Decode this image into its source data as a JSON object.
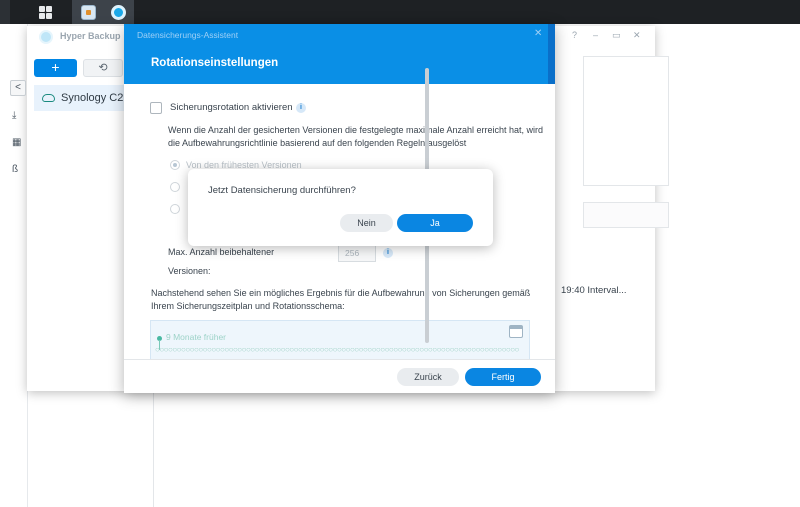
{
  "taskbar": {
    "items": [
      "main-menu",
      "photo-app",
      "hyper-backup"
    ]
  },
  "app": {
    "title": "Hyper Backup",
    "window_controls": [
      "?",
      "–",
      "▭",
      "✕"
    ],
    "add_label": "+",
    "history_label": "⟲",
    "task_name": "Synology C2",
    "schedule_text": "19:40 Interval..."
  },
  "wizard": {
    "header_small": "Datensicherungs-Assistent",
    "title": "Rotationseinstellungen",
    "close_label": "✕",
    "checkbox_label": "Sicherungsrotation aktivieren",
    "description": "Wenn die Anzahl der gesicherten Versionen die festgelegte maximale Anzahl erreicht hat, wird die Aufbewahrungsrichtlinie basierend auf den folgenden Regeln ausgelöst",
    "radio_1_label": "Von den frühesten Versionen",
    "max_versions_label_line1": "Max. Anzahl beibehaltener",
    "max_versions_label_line2": "Versionen:",
    "max_versions_value": "256",
    "result_description": "Nachstehend sehen Sie ein mögliches Ergebnis für die Aufbewahrung von Sicherungen gemäß Ihrem Sicherungszeitplan und Rotationsschema:",
    "timeline_label": "9 Monate früher",
    "back_label": "Zurück",
    "finish_label": "Fertig"
  },
  "confirm": {
    "message": "Jetzt Datensicherung durchführen?",
    "no_label": "Nein",
    "yes_label": "Ja"
  },
  "colors": {
    "accent": "#0a86e2",
    "header": "#0a8fe6",
    "taskbar": "#1e2124"
  }
}
